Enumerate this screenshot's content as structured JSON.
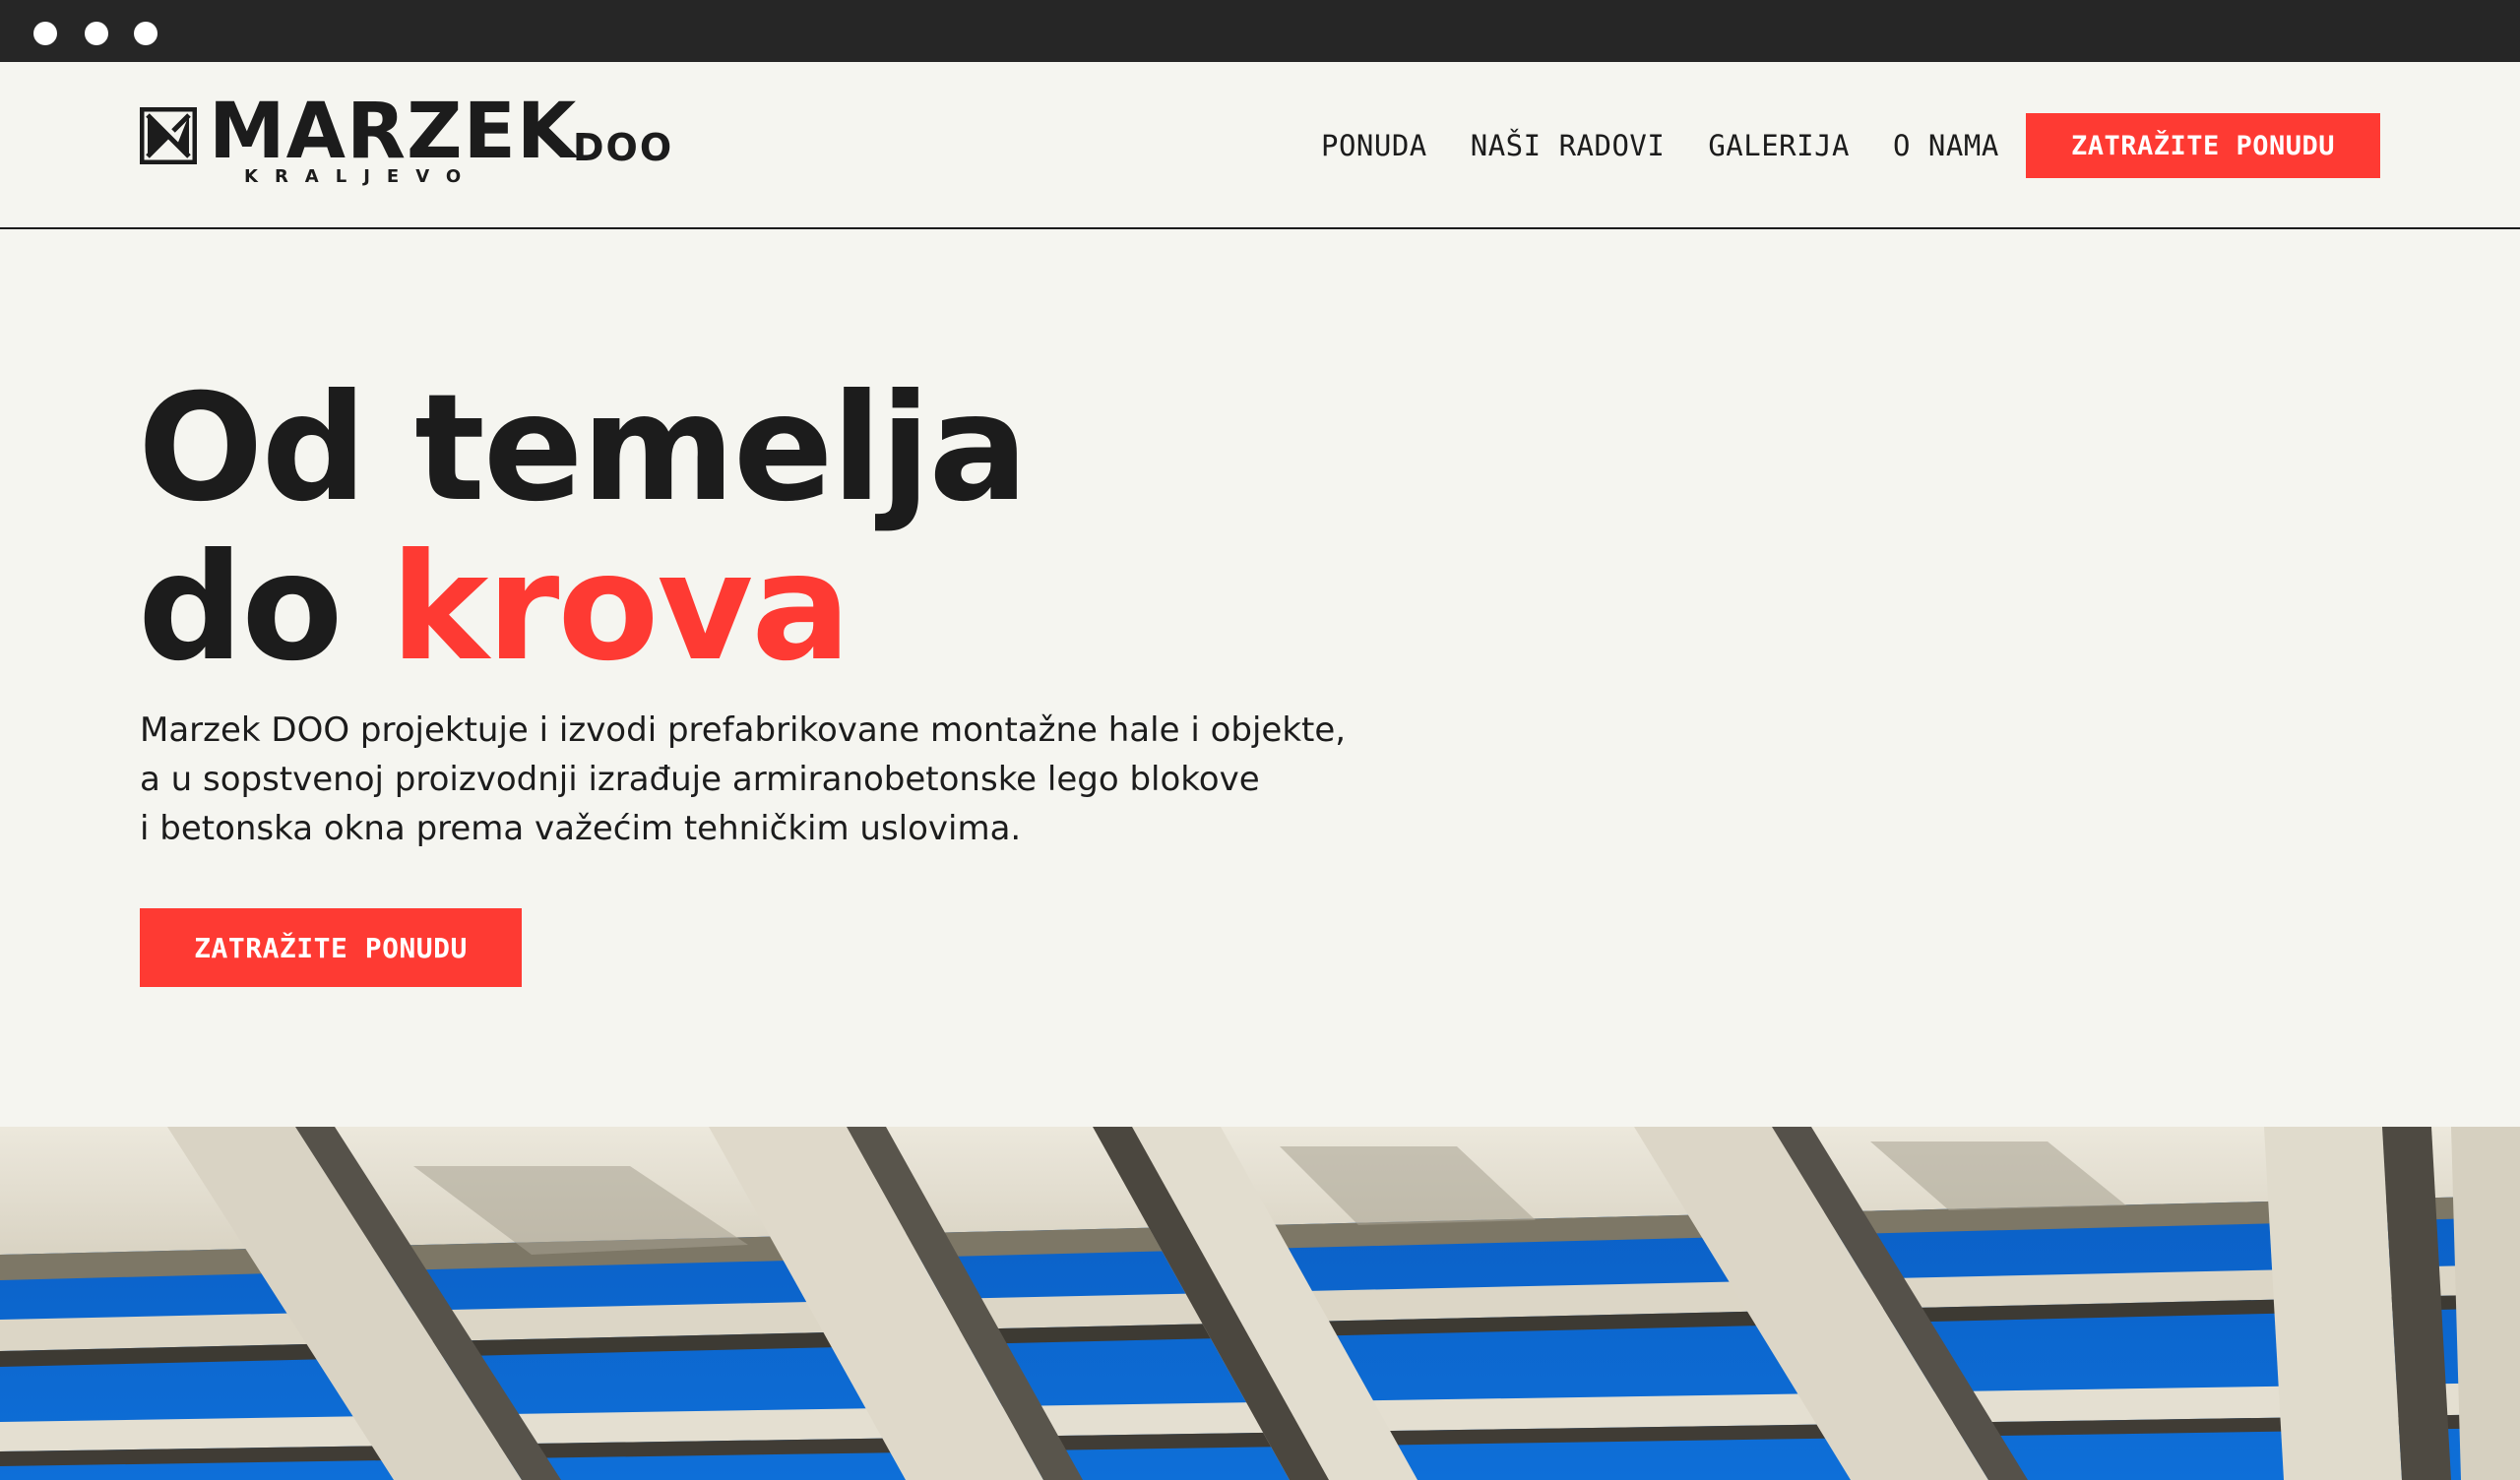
{
  "browser": {
    "window_controls": [
      "close-dot",
      "minimize-dot",
      "maximize-dot"
    ]
  },
  "header": {
    "logo": {
      "wordmark": "MARZEK",
      "suffix": "DOO",
      "city": "KRALJEVO",
      "icon": "marzek-logo-mark"
    },
    "nav": [
      {
        "label": "PONUDA"
      },
      {
        "label": "NAŠI RADOVI"
      },
      {
        "label": "GALERIJA"
      },
      {
        "label": "O NAMA"
      }
    ],
    "cta_label": "ZATRAŽITE PONUDU"
  },
  "hero": {
    "title_line1": "Od temelja",
    "title_line2_prefix": "do ",
    "title_line2_accent": "krova",
    "text_lines": [
      "Marzek DOO projektuje i izvodi prefabrikovane montažne hale i objekte,",
      "a u sopstvenoj proizvodnji izrađuje armiranobetonske lego blokove",
      "i betonska okna prema važećim tehničkim uslovima."
    ],
    "cta_label": "ZATRAŽITE PONUDU",
    "image": "concrete-roof-structure-photo"
  },
  "colors": {
    "accent": "#fe3a33",
    "text": "#1c1c1c",
    "background": "#f5f5f0",
    "chrome": "#262626",
    "sky": "#0b63c9",
    "concrete": "#e6e1d4"
  }
}
